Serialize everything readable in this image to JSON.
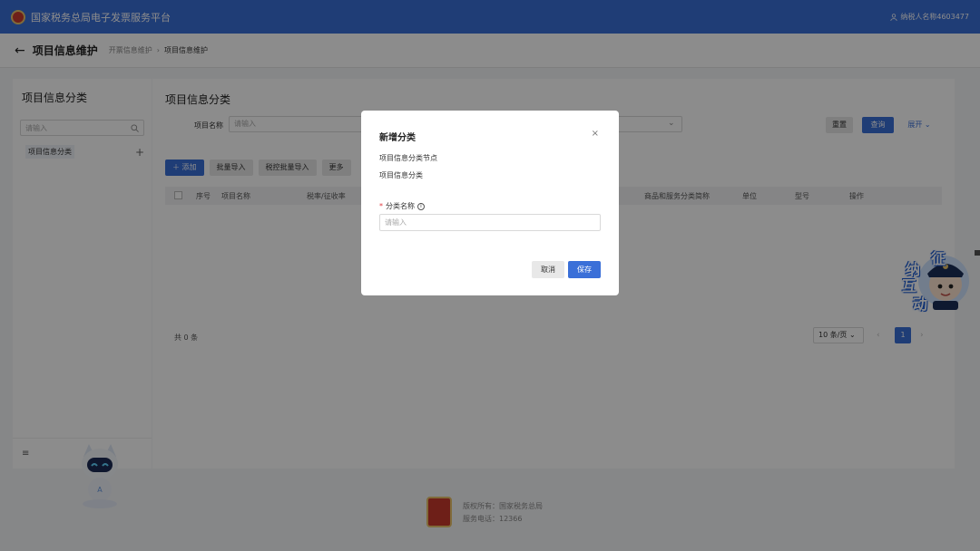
{
  "header": {
    "app_title": "国家税务总局电子发票服务平台",
    "user": "纳税人名称4603477"
  },
  "page": {
    "title": "项目信息维护",
    "breadcrumb": [
      "开票信息维护",
      "项目信息维护"
    ]
  },
  "left_panel": {
    "title": "项目信息分类",
    "search_placeholder": "请输入",
    "tree_node": "项目信息分类",
    "add_glyph": "+",
    "menu_glyph": "≡"
  },
  "main": {
    "title": "项目信息分类",
    "filter_label": "项目名称",
    "filter_placeholder": "请输入",
    "reset_label": "重置",
    "query_label": "查询",
    "expand_label": "展开",
    "toolbar": {
      "add_label": "添加",
      "batch_import_label": "批量导入",
      "tax_batch_import_label": "税控批量导入",
      "more_label": "更多"
    },
    "table_columns": [
      "序号",
      "项目名称",
      "税率/征收率",
      "商品和服务分类简称",
      "单位",
      "型号",
      "操作"
    ],
    "total_text": "共 0 条",
    "page_size": "10 条/页",
    "current_page": "1"
  },
  "modal": {
    "title": "新增分类",
    "parent_label": "项目信息分类节点",
    "parent_value": "项目信息分类",
    "required_mark": "*",
    "field_label": "分类名称",
    "field_placeholder": "请输入",
    "cancel_label": "取消",
    "save_label": "保存"
  },
  "footer": {
    "copyright": "版权所有：国家税务总局",
    "hotline": "服务电话：12366"
  },
  "widget": {
    "chars": [
      "征",
      "纳",
      "互",
      "动"
    ]
  },
  "colors": {
    "primary": "#3a6fd8",
    "header_bg": "#3a6fd8",
    "danger": "#e0393e"
  }
}
